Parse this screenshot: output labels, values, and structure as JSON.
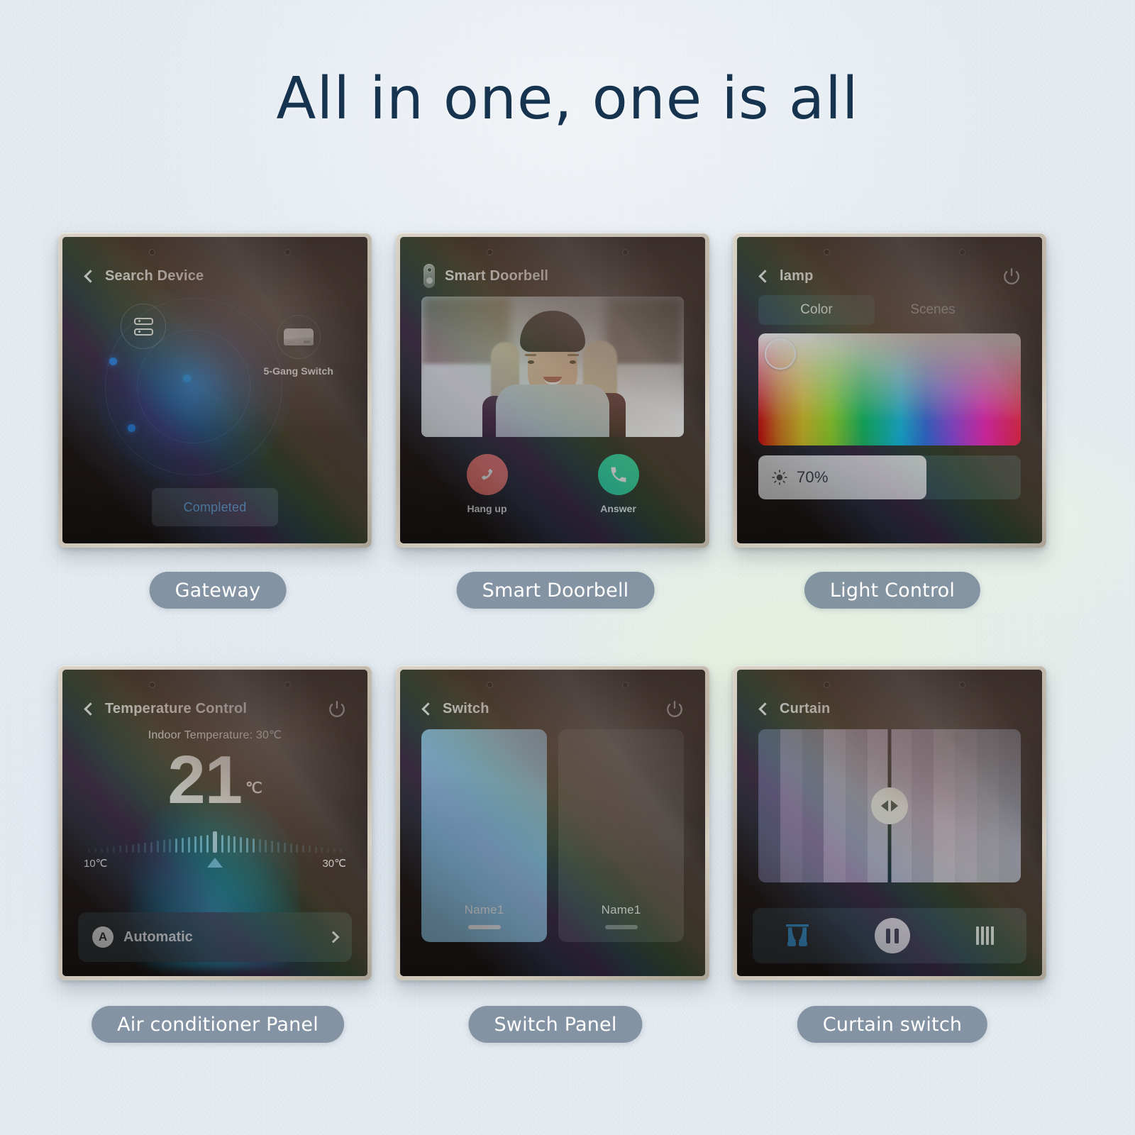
{
  "header": {
    "title": "All in one, one is all"
  },
  "panels": [
    {
      "caption": "Gateway",
      "screen_title": "Search Device",
      "device_label": "5-Gang Switch",
      "action_label": "Completed",
      "icons": {
        "back": "chevron-left-icon",
        "hub": "gateway-hub-icon",
        "device": "switch-device-icon"
      }
    },
    {
      "caption": "Smart Doorbell",
      "screen_title": "Smart Doorbell",
      "hangup_label": "Hang up",
      "answer_label": "Answer",
      "icons": {
        "doorbell": "doorbell-icon",
        "hangup": "phone-hangup-icon",
        "answer": "phone-answer-icon"
      },
      "colors": {
        "hangup": "#f2705e",
        "answer": "#21d6a0"
      }
    },
    {
      "caption": "Light Control",
      "screen_title": "lamp",
      "tabs": [
        {
          "label": "Color",
          "active": true
        },
        {
          "label": "Scenes",
          "active": false
        }
      ],
      "brightness_value": "70%",
      "brightness_fill_percent": 64,
      "icons": {
        "back": "chevron-left-icon",
        "power": "power-icon",
        "brightness": "sun-brightness-icon"
      }
    },
    {
      "caption": "Air conditioner Panel",
      "screen_title": "Temperature Control",
      "ambient_text": "Indoor Temperature: 30℃",
      "set_temp": "21",
      "set_temp_unit": "℃",
      "range_min": "10℃",
      "range_max": "30℃",
      "mode_badge": "A",
      "mode_label": "Automatic",
      "icons": {
        "back": "chevron-left-icon",
        "power": "power-icon",
        "mode": "auto-mode-icon",
        "chevron": "chevron-right-icon"
      }
    },
    {
      "caption": "Switch Panel",
      "screen_title": "Switch",
      "switches": [
        {
          "name": "Name1",
          "state": "on"
        },
        {
          "name": "Name1",
          "state": "off"
        }
      ],
      "icons": {
        "back": "chevron-left-icon",
        "power": "power-icon"
      }
    },
    {
      "caption": "Curtain switch",
      "screen_title": "Curtain",
      "controls": [
        {
          "name": "open-curtain-icon",
          "active": true
        },
        {
          "name": "pause-icon",
          "active": false
        },
        {
          "name": "close-curtain-icon",
          "active": false
        }
      ],
      "icons": {
        "back": "chevron-left-icon",
        "handle": "drag-handle-icon"
      }
    }
  ]
}
